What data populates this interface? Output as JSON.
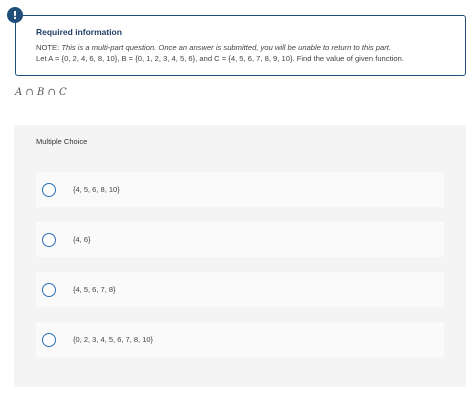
{
  "notice": {
    "badge": "!",
    "title": "Required information",
    "note_label": "NOTE:",
    "note_text": "This is a multi-part question. Once an answer is submitted, you will be unable to return to this part.",
    "problem_text": "Let A = {0, 2, 4, 6, 8, 10}, B = {0, 1, 2, 3, 4, 5, 6}, and C = {4, 5, 6, 7, 8, 9, 10}. Find the value of given function."
  },
  "expression": "A ∩ B ∩ C",
  "question": {
    "type_label": "Multiple Choice",
    "options": [
      {
        "label": "{4, 5, 6, 8, 10}"
      },
      {
        "label": "{4, 6}"
      },
      {
        "label": "{4, 5, 6, 7, 8}"
      },
      {
        "label": "{0, 2, 3, 4, 5, 6, 7, 8, 10}"
      }
    ]
  }
}
